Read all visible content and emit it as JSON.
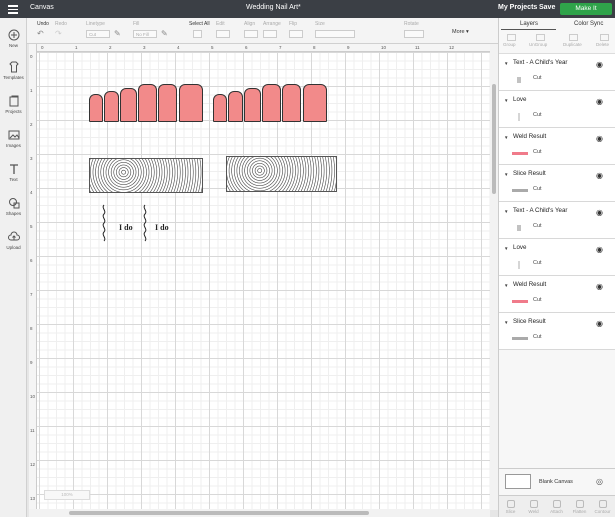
{
  "topbar": {
    "canvas_label": "Canvas",
    "project_title": "Wedding Nail Art*",
    "my_projects": "My Projects",
    "save": "Save",
    "make_it": "Make It"
  },
  "toolbar": {
    "undo": "Undo",
    "redo": "Redo",
    "linetype_label": "Linetype",
    "linetype_value": "Cut",
    "fill_label": "Fill",
    "fill_value": "No Fill",
    "select_all": "Select All",
    "edit": "Edit",
    "align": "Align",
    "arrange": "Arrange",
    "flip": "Flip",
    "size": "Size",
    "rotate": "Rotate",
    "more": "More"
  },
  "sidebar": {
    "items": [
      {
        "label": "New",
        "icon": "plus-circle-icon"
      },
      {
        "label": "Templates",
        "icon": "tshirt-icon"
      },
      {
        "label": "Projects",
        "icon": "projects-icon"
      },
      {
        "label": "Images",
        "icon": "image-icon"
      },
      {
        "label": "Text",
        "icon": "text-icon"
      },
      {
        "label": "Shapes",
        "icon": "shapes-icon"
      },
      {
        "label": "Upload",
        "icon": "upload-icon"
      }
    ]
  },
  "rulers": {
    "top": [
      "0",
      "1",
      "2",
      "3",
      "4",
      "5",
      "6",
      "7",
      "8",
      "9",
      "10",
      "11",
      "12"
    ],
    "left": [
      "0",
      "1",
      "2",
      "3",
      "4",
      "5",
      "6",
      "7",
      "8",
      "9",
      "10",
      "11",
      "12",
      "13"
    ]
  },
  "canvas_art": {
    "ido_text": "I do",
    "nail_color": "#f28a8a"
  },
  "zoom_control": "100%",
  "right_panel": {
    "tabs": [
      "Layers",
      "Color Sync"
    ],
    "tools": [
      "Group",
      "UnGroup",
      "Duplicate",
      "Delete"
    ],
    "layers": [
      {
        "name": "Text - A Child's Year",
        "op": "Cut",
        "thumb": "text"
      },
      {
        "name": "Love",
        "op": "Cut",
        "thumb": "love"
      },
      {
        "name": "Weld Result",
        "op": "Cut",
        "thumb": "pink"
      },
      {
        "name": "Slice Result",
        "op": "Cut",
        "thumb": "gray"
      },
      {
        "name": "Text - A Child's Year",
        "op": "Cut",
        "thumb": "text"
      },
      {
        "name": "Love",
        "op": "Cut",
        "thumb": "love"
      },
      {
        "name": "Weld Result",
        "op": "Cut",
        "thumb": "pink"
      },
      {
        "name": "Slice Result",
        "op": "Cut",
        "thumb": "gray"
      }
    ],
    "blank_canvas": "Blank Canvas",
    "bottom_tools": [
      "Slice",
      "Weld",
      "Attach",
      "Flatten",
      "Contour"
    ]
  },
  "colors": {
    "topbar": "#3b3f45",
    "make_it": "#2fa34a",
    "weld_thumb": "#f07b8a",
    "slice_thumb": "#aaaaaa"
  }
}
